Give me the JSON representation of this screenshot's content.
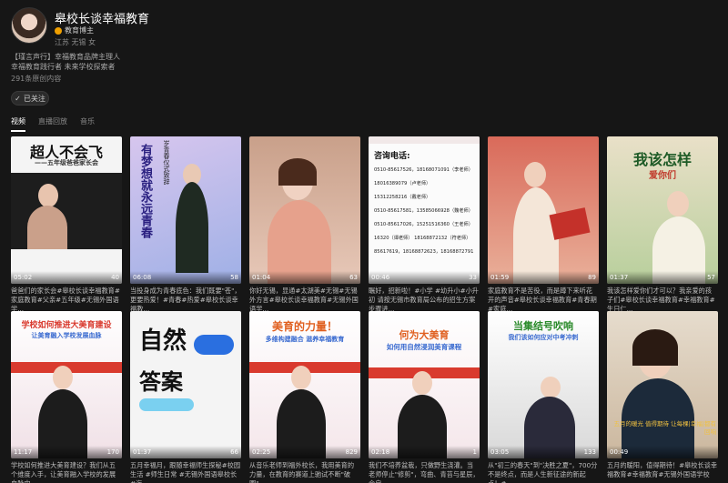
{
  "profile": {
    "name": "皋校长谈幸福教育",
    "badge": "教育博主",
    "location": "江苏 无锡 女",
    "intro_line1": "【瑾言声行】幸福教育品牌主理人",
    "intro_line2": "幸福教育践行者 未来学校探索者",
    "count": "291条原创内容",
    "follow_label": "已关注"
  },
  "tabs": [
    {
      "label": "视频",
      "active": true
    },
    {
      "label": "直播回放",
      "active": false
    },
    {
      "label": "音乐",
      "active": false
    }
  ],
  "cards": [
    {
      "duration": "05:02",
      "likes": "40",
      "title": "超人不会飞",
      "subtitle": "——五年级爸爸家长会",
      "caption": "爸爸们的家长会#皋校长谈幸福教育#家庭教育#父亲#五年级#无锡外国语学..."
    },
    {
      "duration": "06:08",
      "likes": "58",
      "title": "有梦想就永远青春",
      "subtitle": "岁青春仪式致辞",
      "caption": "当投身成为青春底色：我们既要\"苍\"，更要热爱！#青春#热爱#皋校长谈幸福教..."
    },
    {
      "duration": "01:04",
      "likes": "63",
      "title": "",
      "subtitle": "",
      "caption": "你好无锡，显通#太湖美#无锡#无锡外方言#皋校长谈幸福教育#无锡外国语学..."
    },
    {
      "duration": "00:46",
      "likes": "33",
      "title": "咨询电话:",
      "subtitle": "",
      "phones": [
        "0510-85617526，18168071091（李老师）",
        "18016389079（卢老师）",
        "15312258216（戴老师）",
        "0510-85617581，13585066928（魏老师）",
        "0510-85617026，15251516360（王老师）",
        "16320（谭老师） 18168872132（符老师）",
        "85617619，18168872623，18168872791"
      ],
      "caption": "瞩好，招新啦！#小学 #幼升小#小升初 请按无锡市教育局公布的招生方案步骤进..."
    },
    {
      "duration": "01:59",
      "likes": "89",
      "title": "",
      "subtitle": "",
      "caption": "家庭教育不是苦役，而是蹲下来听花开的声音#皋校长谈幸福教育#青春期 #家庭..."
    },
    {
      "duration": "01:37",
      "likes": "57",
      "title": "我该怎样",
      "subtitle": "爱你们",
      "caption": "我该怎样爱你们才可以？我亲爱的孩子们#皋校长谈幸福教育#幸福教育#生日仁..."
    },
    {
      "duration": "11:17",
      "likes": "170",
      "title": "学校如何推进大美育建设",
      "subtitle": "让美育融入学校发展血脉",
      "caption": "学校如何推进大美育建设？我们从五个维度入手，让美育融入学校的发展血脉中..."
    },
    {
      "duration": "01:37",
      "likes": "66",
      "title": "自然",
      "subtitle": "答案",
      "caption": "五月幸福月，跟随幸福师生探秘#校园生活 #师生日常 #无锡外国语皋校长 #海..."
    },
    {
      "duration": "02:25",
      "likes": "829",
      "title": "美育的力量！",
      "subtitle": "多维构建融合 滋养幸福教育",
      "caption": "从音乐老师到福外校长，我用美育的力量，在教育的赛道上驰试不断\"破圈\"..."
    },
    {
      "duration": "02:18",
      "likes": "1",
      "title": "何为大美育",
      "subtitle": "如何用自然浸润美育课程",
      "caption": "我们不培养盆栽，只做野生浇灌。当老师停止\"修剪\"，弯曲、青苔与星辰，会自..."
    },
    {
      "duration": "03:05",
      "likes": "133",
      "title": "当集结号吹响",
      "subtitle": "我们该如何应对中考冲刺",
      "caption": "从\"初三的春天\"到\"决胜之夏\"，700分不是终点，而是人生新征途的新起点！#..."
    },
    {
      "duration": "00:49",
      "likes": "",
      "title": "",
      "subtitle": "五月的暖光 值得期待 让每棵|幸福|都有回响",
      "caption": "五月的暖阳，值得期待！#皋校长谈幸福教育#幸福教育#无锡外国语学校"
    }
  ],
  "colors": {
    "background": "#161616",
    "accent": "#f0a000"
  }
}
